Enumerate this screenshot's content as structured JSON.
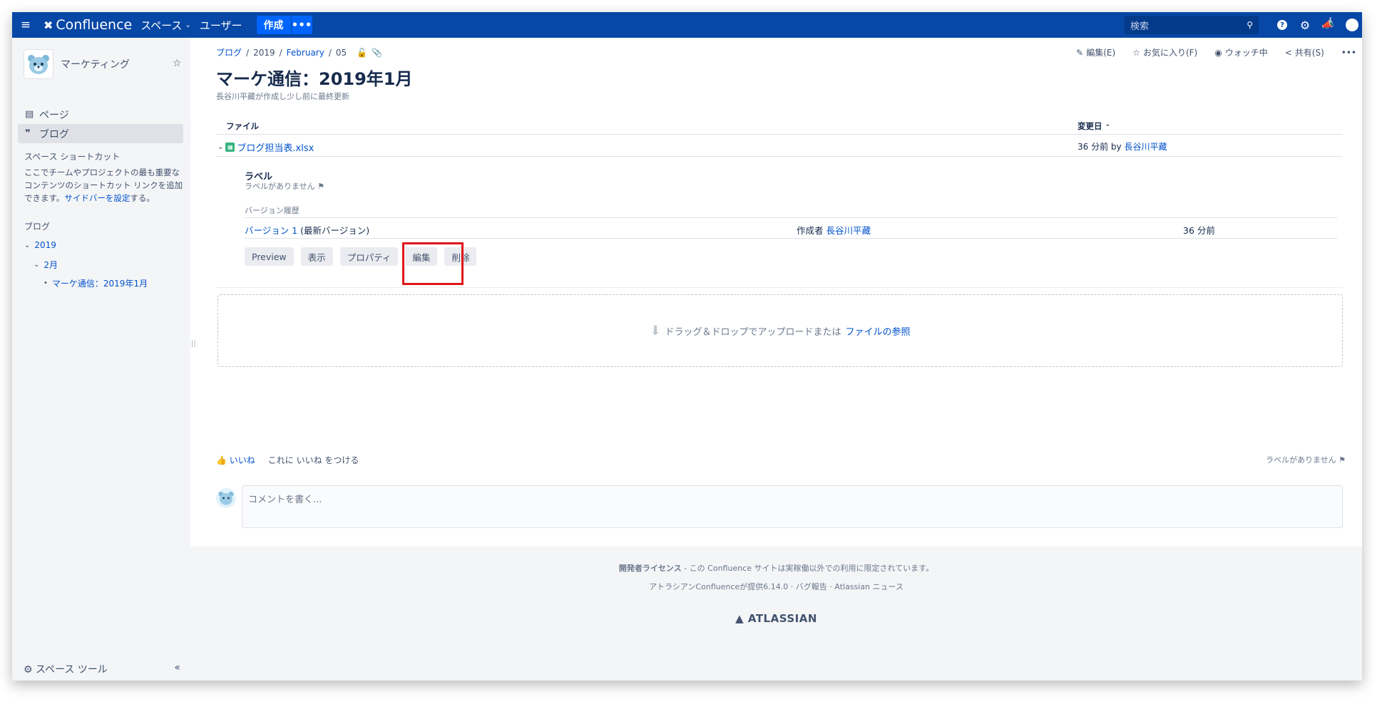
{
  "header": {
    "logo": "Confluence",
    "nav": [
      "スペース",
      "ユーザー"
    ],
    "create_label": "作成",
    "more_label": "•••",
    "search_placeholder": "検索",
    "notifications_count": "1"
  },
  "sidebar": {
    "space_name": "マーケティング",
    "items": [
      {
        "label": "ページ"
      },
      {
        "label": "ブログ"
      }
    ],
    "shortcut_title": "スペース ショートカット",
    "shortcut_desc_1": "ここでチームやプロジェクトの最も重要なコンテンツのショートカット リンクを追加できます。",
    "shortcut_desc_link": "サイドバーを設定",
    "shortcut_desc_2": "する。",
    "blog_title": "ブログ",
    "tree": {
      "year": "2019",
      "month": "2月",
      "post": "マーケ通信：2019年1月"
    },
    "space_tools": "スペース ツール",
    "collapse": "«"
  },
  "breadcrumb": {
    "root": "ブログ",
    "year": "2019",
    "month": "February",
    "day": "05"
  },
  "actions": {
    "edit": "編集(E)",
    "favorite": "お気に入り(F)",
    "watch": "ウォッチ中",
    "share": "共有(S)",
    "more": "•••"
  },
  "page": {
    "title": "マーケ通信：2019年1月",
    "byline": "長谷川平藏が作成し少し前に最終更新"
  },
  "attachments": {
    "col_file": "ファイル",
    "col_modified": "変更日",
    "file": {
      "name": "ブログ担当表.xlsx",
      "modified_prefix": "36 分前 by",
      "modified_by": "長谷川平藏"
    },
    "label_title": "ラベル",
    "label_none": "ラベルがありません",
    "version_history_title": "バージョン履歴",
    "version": {
      "name": "バージョン 1",
      "note": "(最新バージョン)",
      "author_prefix": "作成者",
      "author": "長谷川平藏",
      "time": "36 分前"
    },
    "buttons": {
      "preview": "Preview",
      "view": "表示",
      "properties": "プロパティ",
      "edit": "編集",
      "delete": "削除"
    },
    "dropzone_text": "ドラッグ＆ドロップでアップロードまたは",
    "dropzone_link": "ファイルの参照"
  },
  "likes": {
    "like": "いいね",
    "be_first": "これに いいね をつける",
    "no_labels": "ラベルがありません"
  },
  "comment": {
    "placeholder": "コメントを書く..."
  },
  "footer": {
    "license_bold": "開発者ライセンス",
    "license_rest": " - この Confluence サイトは実稼働以外での利用に限定されています。",
    "powered": "アトラシアンConfluenceが提供6.14.0",
    "bug": "バグ報告",
    "news": "Atlassian ニュース",
    "brand": "ATLASSIAN"
  },
  "colors": {
    "header_bg": "#0747a6",
    "link": "#0052cc",
    "highlight": "#e0151a"
  }
}
